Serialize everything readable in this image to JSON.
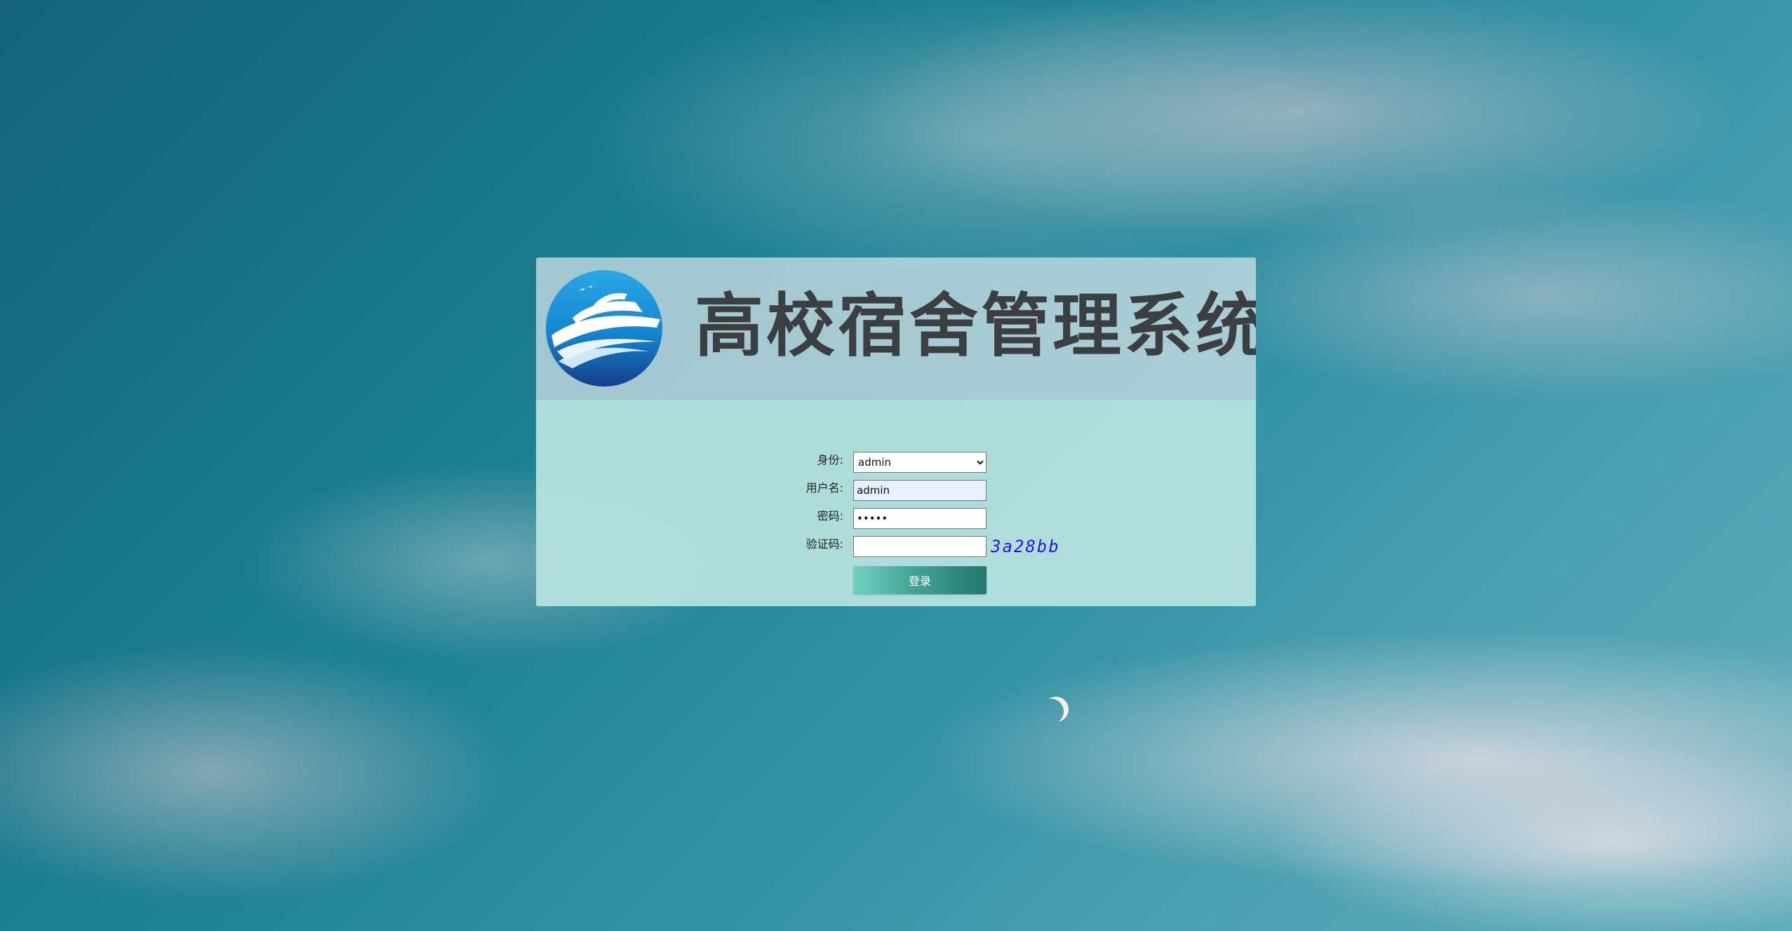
{
  "header": {
    "title": "高校宿舍管理系统",
    "logo_icon": "ship-wave-logo-icon"
  },
  "form": {
    "identity_label": "身份:",
    "identity_selected": "admin",
    "identity_options": [
      "admin"
    ],
    "username_label": "用户名:",
    "username_value": "admin",
    "password_label": "密码:",
    "password_value": "•••••",
    "captcha_label": "验证码:",
    "captcha_value": "",
    "captcha_image_text": "3a28bb",
    "login_button_label": "登录"
  },
  "colors": {
    "title_text": "#3b3f42",
    "panel_body": "#b9e4e0",
    "login_button": "#44a494",
    "captcha_text": "#1a1adf"
  }
}
